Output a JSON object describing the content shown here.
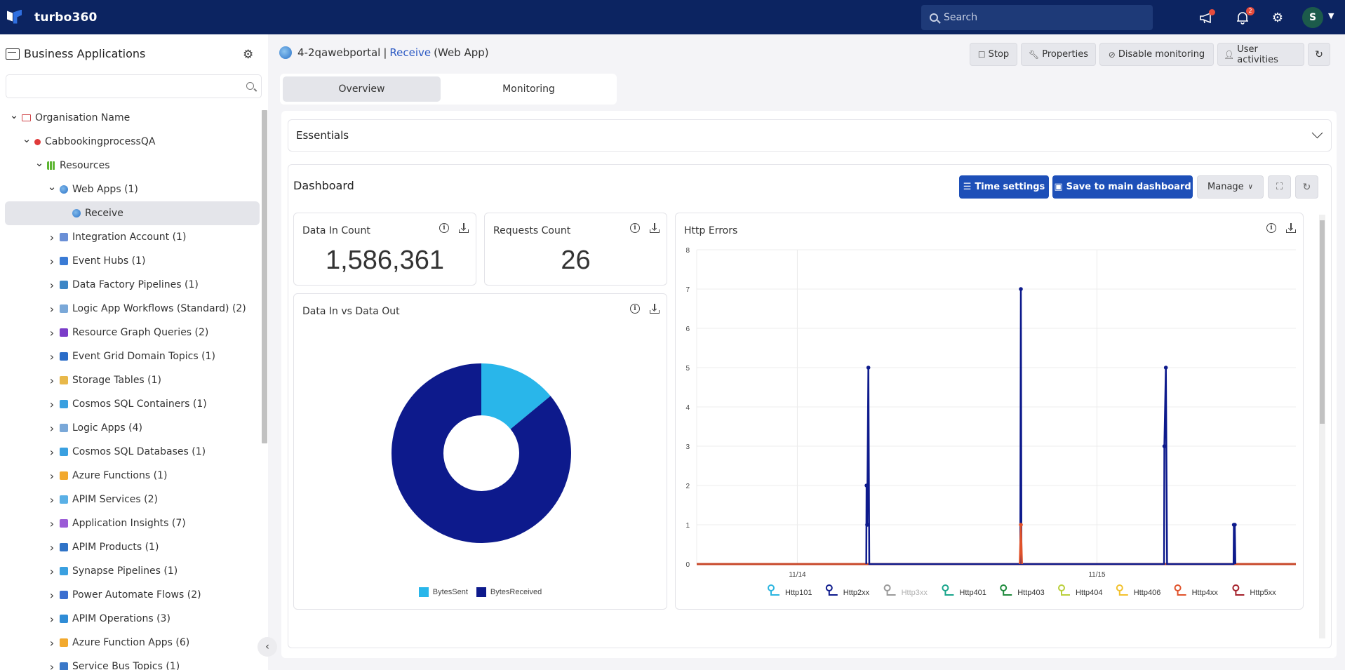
{
  "app": {
    "name": "turbo360",
    "search_placeholder": "Search",
    "notifications_count": "2",
    "user_initial": "S"
  },
  "sidebar": {
    "title": "Business Applications",
    "search_value": "",
    "tree": [
      {
        "label": "Organisation Name",
        "level": 0,
        "expanded": true,
        "icon": "folder-icon"
      },
      {
        "label": "CabbookingprocessQA",
        "level": 1,
        "expanded": true,
        "icon": "status-dot-icon"
      },
      {
        "label": "Resources",
        "level": 2,
        "expanded": true,
        "icon": "grid-icon"
      },
      {
        "label": "Web Apps (1)",
        "level": 3,
        "expanded": true,
        "icon": "web-app-icon"
      },
      {
        "label": "Receive",
        "level": 4,
        "selected": true,
        "icon": "web-app-icon"
      },
      {
        "label": "Integration Account (1)",
        "level": 3,
        "icon": "integration-account-icon"
      },
      {
        "label": "Event Hubs (1)",
        "level": 3,
        "icon": "event-hubs-icon"
      },
      {
        "label": "Data Factory Pipelines (1)",
        "level": 3,
        "icon": "data-factory-icon"
      },
      {
        "label": "Logic App Workflows (Standard) (2)",
        "level": 3,
        "icon": "logic-app-icon"
      },
      {
        "label": "Resource Graph Queries (2)",
        "level": 3,
        "icon": "resource-graph-icon"
      },
      {
        "label": "Event Grid Domain Topics (1)",
        "level": 3,
        "icon": "event-grid-icon"
      },
      {
        "label": "Storage Tables (1)",
        "level": 3,
        "icon": "storage-table-icon"
      },
      {
        "label": "Cosmos SQL Containers (1)",
        "level": 3,
        "icon": "cosmos-icon"
      },
      {
        "label": "Logic Apps (4)",
        "level": 3,
        "icon": "logic-app-icon"
      },
      {
        "label": "Cosmos SQL Databases (1)",
        "level": 3,
        "icon": "cosmos-icon"
      },
      {
        "label": "Azure Functions (1)",
        "level": 3,
        "icon": "function-icon"
      },
      {
        "label": "APIM Services (2)",
        "level": 3,
        "icon": "apim-service-icon"
      },
      {
        "label": "Application Insights (7)",
        "level": 3,
        "icon": "app-insights-icon"
      },
      {
        "label": "APIM Products (1)",
        "level": 3,
        "icon": "apim-product-icon"
      },
      {
        "label": "Synapse Pipelines (1)",
        "level": 3,
        "icon": "synapse-icon"
      },
      {
        "label": "Power Automate Flows (2)",
        "level": 3,
        "icon": "power-automate-icon"
      },
      {
        "label": "APIM Operations (3)",
        "level": 3,
        "icon": "apim-operation-icon"
      },
      {
        "label": "Azure Function Apps (6)",
        "level": 3,
        "icon": "function-icon"
      },
      {
        "label": "Service Bus Topics (1)",
        "level": 3,
        "icon": "service-bus-icon"
      }
    ]
  },
  "header": {
    "resource_group": "4-2qawebportal",
    "separator": "|",
    "resource_name": "Receive",
    "resource_type": "(Web App)",
    "actions": {
      "stop": "Stop",
      "properties": "Properties",
      "disable_monitoring": "Disable monitoring",
      "user_activities": "User activities"
    }
  },
  "tabs": [
    {
      "label": "Overview",
      "active": true
    },
    {
      "label": "Monitoring",
      "active": false
    }
  ],
  "essentials": {
    "label": "Essentials"
  },
  "dashboard": {
    "title": "Dashboard",
    "time_settings": "Time settings",
    "save_main": "Save to main dashboard",
    "manage": "Manage",
    "widgets": {
      "data_in_count": {
        "title": "Data In Count",
        "value": "1,586,361"
      },
      "requests_count": {
        "title": "Requests Count",
        "value": "26"
      },
      "data_in_vs_out": {
        "title": "Data In vs Data Out"
      },
      "http_errors": {
        "title": "Http Errors"
      }
    }
  },
  "chart_data": [
    {
      "type": "pie",
      "title": "Data In vs Data Out",
      "donut": true,
      "categories": [
        "BytesSent",
        "BytesReceived"
      ],
      "values": [
        14,
        86
      ],
      "colors": [
        "#29b6ea",
        "#0d1a8c"
      ],
      "legend": "bottom"
    },
    {
      "type": "line",
      "title": "Http Errors",
      "ylim": [
        0,
        8
      ],
      "yticks": [
        0,
        1,
        2,
        3,
        4,
        5,
        6,
        7,
        8
      ],
      "xtick_labels": [
        {
          "label": "11/14",
          "x": 0.168
        },
        {
          "label": "11/15",
          "x": 0.668
        }
      ],
      "grid": true,
      "legend": "bottom",
      "series": [
        {
          "name": "Http101",
          "color": "#2cb5e0",
          "disabled": false,
          "points": []
        },
        {
          "name": "Http2xx",
          "color": "#0d1a8c",
          "disabled": false,
          "points": [
            [
              0.283,
              0
            ],
            [
              0.2835,
              2
            ],
            [
              0.2845,
              1
            ],
            [
              0.2865,
              5
            ],
            [
              0.288,
              0
            ],
            [
              0.54,
              0
            ],
            [
              0.541,
              7
            ],
            [
              0.542,
              0
            ],
            [
              0.78,
              0
            ],
            [
              0.7805,
              3
            ],
            [
              0.783,
              5
            ],
            [
              0.785,
              0
            ],
            [
              0.896,
              0
            ],
            [
              0.8965,
              1
            ],
            [
              0.898,
              1
            ],
            [
              0.899,
              0
            ]
          ]
        },
        {
          "name": "Http3xx",
          "color": "#999999",
          "disabled": true,
          "points": []
        },
        {
          "name": "Http401",
          "color": "#1aa58c",
          "disabled": false,
          "points": []
        },
        {
          "name": "Http403",
          "color": "#1e8a3c",
          "disabled": false,
          "points": []
        },
        {
          "name": "Http404",
          "color": "#b9cf3a",
          "disabled": false,
          "points": []
        },
        {
          "name": "Http406",
          "color": "#f2c12e",
          "disabled": false,
          "points": []
        },
        {
          "name": "Http4xx",
          "color": "#e0522a",
          "disabled": false,
          "points": [
            [
              0.539,
              0
            ],
            [
              0.541,
              1
            ],
            [
              0.543,
              0
            ]
          ]
        },
        {
          "name": "Http5xx",
          "color": "#a4202a",
          "disabled": false,
          "points": []
        }
      ]
    }
  ]
}
